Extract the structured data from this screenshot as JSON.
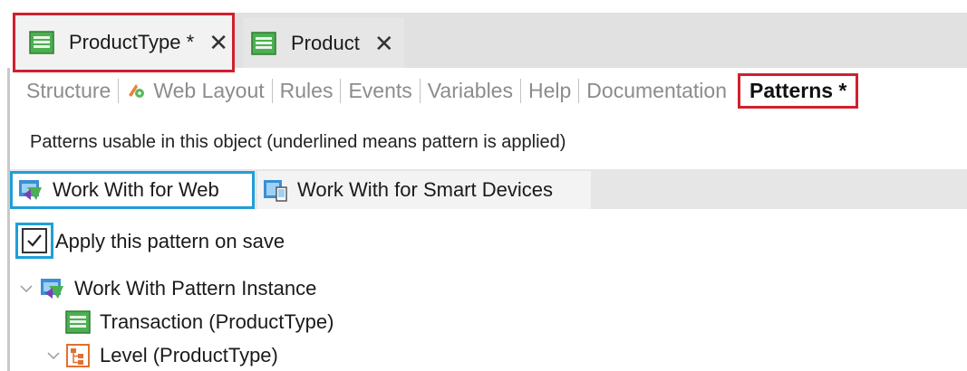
{
  "doc_tabs": [
    {
      "label": "ProductType *",
      "close": "✕",
      "icon": "transaction-icon"
    },
    {
      "label": "Product",
      "close": "✕",
      "icon": "transaction-icon"
    }
  ],
  "sub_tabs": [
    {
      "label": "Structure"
    },
    {
      "label": "Web Layout",
      "icon": "web-layout-icon"
    },
    {
      "label": "Rules"
    },
    {
      "label": "Events"
    },
    {
      "label": "Variables"
    },
    {
      "label": "Help"
    },
    {
      "label": "Documentation"
    },
    {
      "label": "Patterns *",
      "active": true
    }
  ],
  "patterns": {
    "description": "Patterns usable in this object (underlined means pattern is applied)",
    "tabs": [
      {
        "label": "Work With for Web",
        "icon": "work-with-web-icon",
        "active": true
      },
      {
        "label": "Work With for Smart Devices",
        "icon": "work-with-smart-devices-icon"
      }
    ],
    "apply_on_save": {
      "label": "Apply this pattern on save",
      "checked": true
    },
    "tree": [
      {
        "label": "Work With Pattern Instance",
        "icon": "work-with-pattern-icon",
        "expanded": true
      },
      {
        "label": "Transaction (ProductType)",
        "icon": "transaction-icon"
      },
      {
        "label": "Level (ProductType)",
        "icon": "level-icon",
        "expanded": true
      }
    ]
  },
  "colors": {
    "highlight_red": "#d0202e",
    "highlight_blue": "#1f9fd8",
    "disabled_text": "#8c8c8c"
  }
}
